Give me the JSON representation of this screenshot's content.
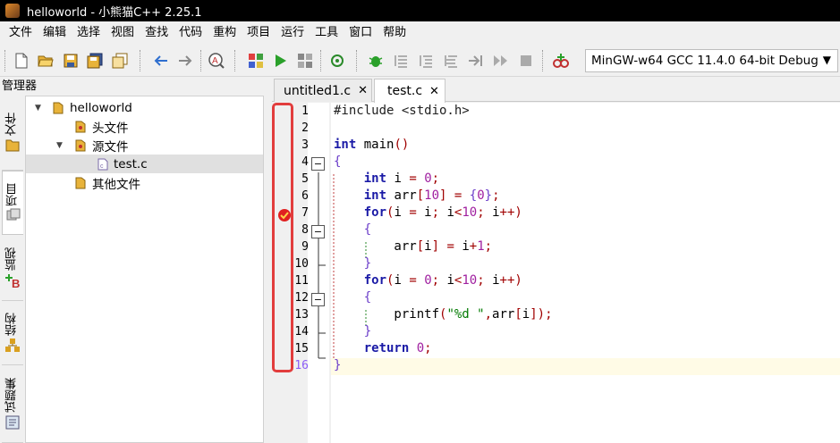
{
  "window": {
    "title": "helloworld - 小熊猫C++ 2.25.1"
  },
  "menu": [
    "文件",
    "编辑",
    "选择",
    "视图",
    "查找",
    "代码",
    "重构",
    "项目",
    "运行",
    "工具",
    "窗口",
    "帮助"
  ],
  "toolbar": {
    "compiler": "MinGW-w64 GCC 11.4.0 64-bit Debug"
  },
  "panel": {
    "title": "管理器"
  },
  "left_tabs": [
    "文件",
    "项目",
    "监视",
    "结构",
    "试题集"
  ],
  "tree": {
    "root": "helloworld",
    "headers": "头文件",
    "sources": "源文件",
    "file": "test.c",
    "others": "其他文件"
  },
  "tabs": [
    {
      "label": "untitled1.c"
    },
    {
      "label": "test.c"
    }
  ],
  "line_numbers": [
    "1",
    "2",
    "3",
    "4",
    "5",
    "6",
    "7",
    "8",
    "9",
    "10",
    "11",
    "12",
    "13",
    "14",
    "15",
    "16"
  ],
  "code": [
    "#include <stdio.h>",
    "",
    "int main()",
    "{",
    "    int i = 0;",
    "    int arr[10] = {0};",
    "    for(i = i; i<10; i++)",
    "    {",
    "        arr[i] = i+1;",
    "    }",
    "    for(i = 0; i<10; i++)",
    "    {",
    "        printf(\"%d \",arr[i]);",
    "    }",
    "    return 0;",
    "}"
  ],
  "breakpoint_line": 7,
  "current_line": 16,
  "colors": {
    "keyword": "#1a1aa6",
    "number": "#a020a0",
    "string": "#007a00",
    "highlight": "#e23d3d"
  }
}
